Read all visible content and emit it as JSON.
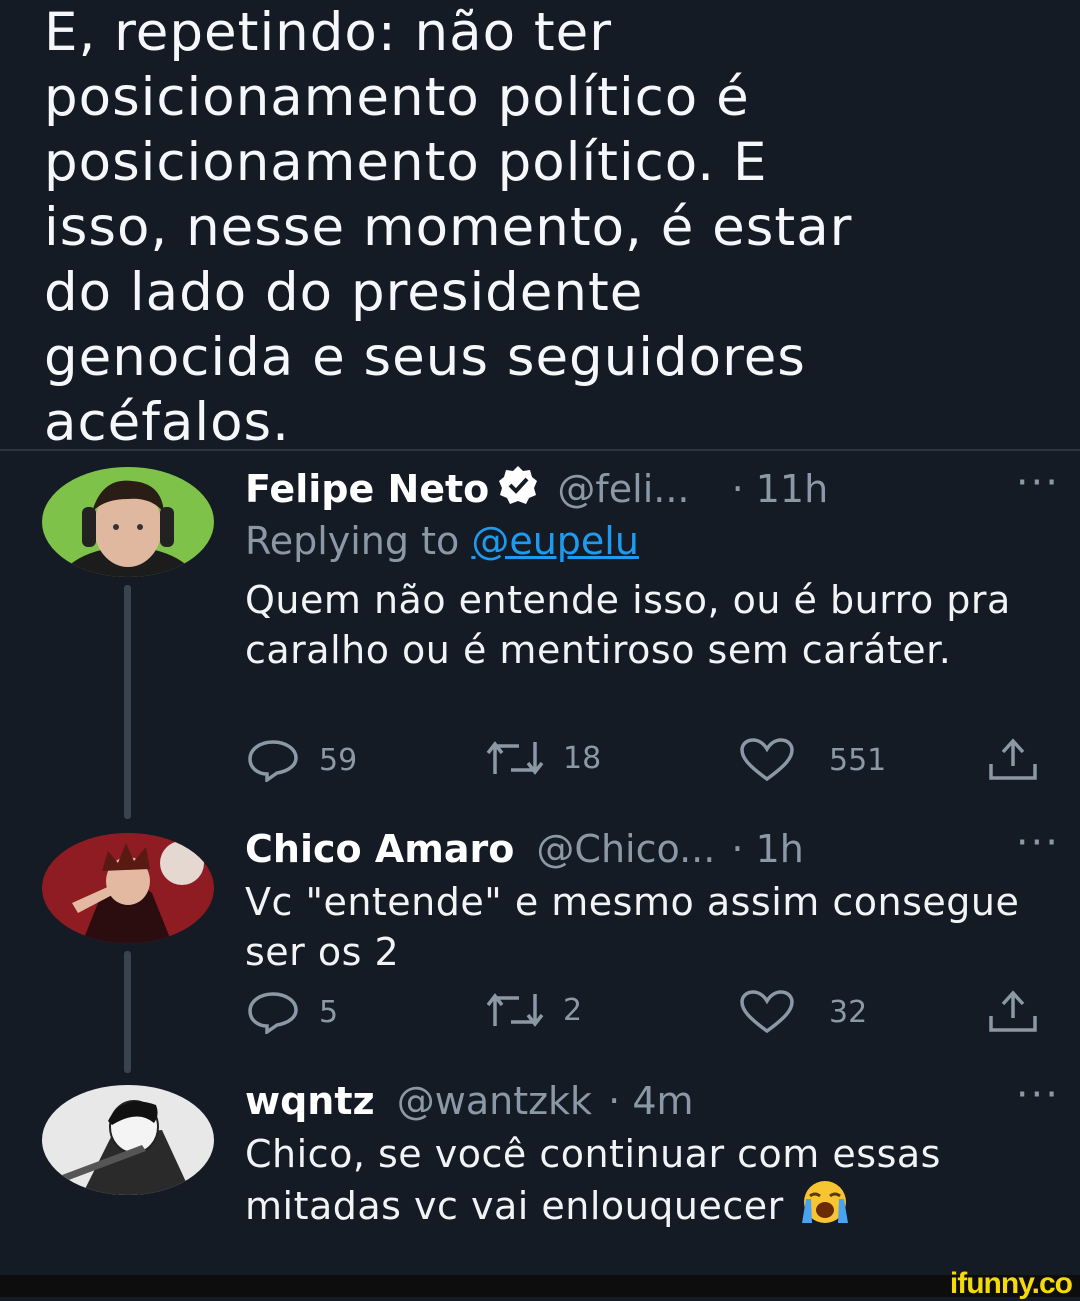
{
  "quote": {
    "lines": [
      "E, repetindo: não ter",
      "posicionamento político é",
      "posicionamento político. E",
      "isso, nesse momento, é estar",
      "do lado do presidente",
      "genocida e seus seguidores",
      "acéfalos."
    ]
  },
  "tweets": [
    {
      "name": "Felipe Neto",
      "verified": true,
      "handle": "@feli...",
      "time": "· 11h",
      "more": "···",
      "replying_prefix": "Replying to ",
      "replying_handle": "@eupelu",
      "body": "Quem não entende isso, ou é burro pra caralho ou é mentiroso sem caráter.",
      "replies": "59",
      "retweets": "18",
      "likes": "551"
    },
    {
      "name": "Chico Amaro",
      "handle": "@Chico...",
      "time": "· 1h",
      "more": "···",
      "body": "Vc \"entende\" e mesmo assim consegue ser os 2",
      "replies": "5",
      "retweets": "2",
      "likes": "32"
    },
    {
      "name": "wqntz",
      "handle": "@wantzkk",
      "time": "· 4m",
      "more": "···",
      "body": "Chico, se você continuar com essas mitadas vc vai enlouquecer",
      "emoji": "loudly-crying-face"
    }
  ],
  "watermark": "ifunny.co",
  "colors": {
    "background": "#151b25",
    "secondary_text": "#8b98a5",
    "link": "#1d9bf0",
    "watermark": "#f5d90a"
  }
}
